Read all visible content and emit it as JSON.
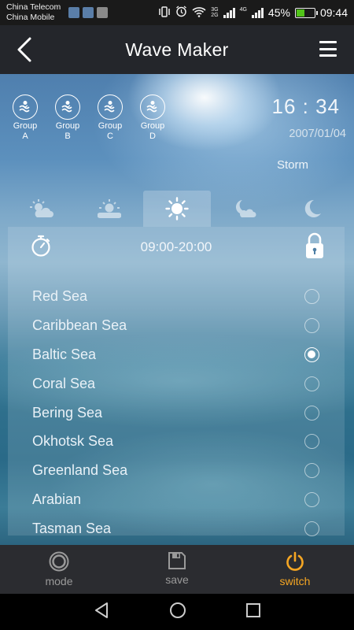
{
  "status_bar": {
    "carrier_1": "China Telecom",
    "carrier_2": "China Mobile",
    "network_top": "3G",
    "network_bottom": "2G",
    "network_4g": "4G",
    "battery_percent": "45%",
    "battery_level": 0.45,
    "time": "09:44"
  },
  "header": {
    "title": "Wave Maker",
    "back_icon": "back-chevron-icon",
    "menu_icon": "hamburger-menu-icon"
  },
  "groups": [
    {
      "line1": "Group",
      "line2": "A"
    },
    {
      "line1": "Group",
      "line2": "B"
    },
    {
      "line1": "Group",
      "line2": "C"
    },
    {
      "line1": "Group",
      "line2": "D"
    }
  ],
  "clock": {
    "time": "16 : 34",
    "date": "2007/01/04",
    "mode": "Storm"
  },
  "weather_tabs": [
    {
      "icon": "sunrise-cloud-icon",
      "active": false
    },
    {
      "icon": "sun-cloud-icon",
      "active": false
    },
    {
      "icon": "sun-icon",
      "active": true
    },
    {
      "icon": "moon-cloud-icon",
      "active": false
    },
    {
      "icon": "moon-icon",
      "active": false
    }
  ],
  "schedule": {
    "time_range": "09:00-20:00",
    "locked": true
  },
  "seas": [
    {
      "name": "Red Sea",
      "selected": false
    },
    {
      "name": "Caribbean Sea",
      "selected": false
    },
    {
      "name": "Baltic Sea",
      "selected": true
    },
    {
      "name": "Coral Sea",
      "selected": false
    },
    {
      "name": "Bering Sea",
      "selected": false
    },
    {
      "name": "Okhotsk Sea",
      "selected": false
    },
    {
      "name": "Greenland Sea",
      "selected": false
    },
    {
      "name": "Arabian",
      "selected": false
    },
    {
      "name": "Tasman Sea",
      "selected": false
    }
  ],
  "toolbar": {
    "mode_label": "mode",
    "save_label": "save",
    "switch_label": "switch",
    "active_color": "#f5a623",
    "inactive_color": "#9a9a9a"
  }
}
